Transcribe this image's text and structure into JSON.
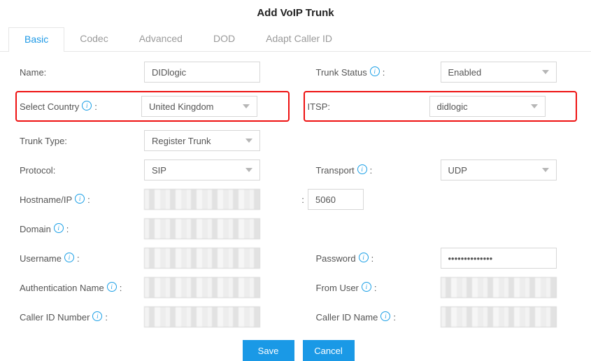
{
  "title": "Add VoIP Trunk",
  "tabs": [
    {
      "label": "Basic",
      "active": true
    },
    {
      "label": "Codec"
    },
    {
      "label": "Advanced"
    },
    {
      "label": "DOD"
    },
    {
      "label": "Adapt Caller ID"
    }
  ],
  "labels": {
    "name": "Name:",
    "trunk_status": "Trunk Status",
    "select_country": "Select Country",
    "itsp": "ITSP:",
    "trunk_type": "Trunk Type:",
    "protocol": "Protocol:",
    "transport": "Transport",
    "hostname": "Hostname/IP",
    "domain": "Domain",
    "username": "Username",
    "password": "Password",
    "auth_name": "Authentication Name",
    "from_user": "From User",
    "cid_number": "Caller ID Number",
    "cid_name": "Caller ID Name"
  },
  "values": {
    "name": "DIDlogic",
    "trunk_status": "Enabled",
    "select_country": "United Kingdom",
    "itsp": "didlogic",
    "trunk_type": "Register Trunk",
    "protocol": "SIP",
    "transport": "UDP",
    "port": "5060",
    "password": "••••••••••••••"
  },
  "buttons": {
    "save": "Save",
    "cancel": "Cancel"
  },
  "colon": ":",
  "suffix_colon": ":"
}
